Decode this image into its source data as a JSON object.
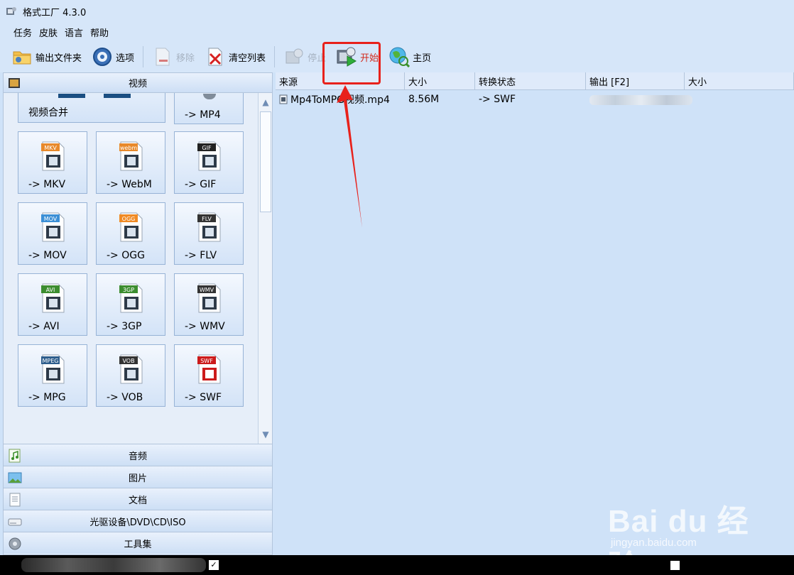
{
  "window": {
    "title": "格式工厂 4.3.0"
  },
  "menu": {
    "items": [
      "任务",
      "皮肤",
      "语言",
      "帮助"
    ]
  },
  "toolbar": {
    "output_folder": "输出文件夹",
    "options": "选项",
    "remove": "移除",
    "clear_list": "清空列表",
    "stop": "停止",
    "start": "开始",
    "home": "主页"
  },
  "left_panel": {
    "video_header": "视频",
    "partial_tiles": [
      "视频合并",
      "-> MP4"
    ],
    "tiles": [
      {
        "label": "-> MKV",
        "badge": "MKV",
        "badge_color": "#e8892a",
        "icon": "film-icon"
      },
      {
        "label": "-> WebM",
        "badge": "webm",
        "badge_color": "#e8892a",
        "icon": "film-icon"
      },
      {
        "label": "-> GIF",
        "badge": "GIF",
        "badge_color": "#222222",
        "icon": "image-icon"
      },
      {
        "label": "-> MOV",
        "badge": "MOV",
        "badge_color": "#3b8fd6",
        "icon": "quicktime-icon"
      },
      {
        "label": "-> OGG",
        "badge": "OGG",
        "badge_color": "#f08a24",
        "icon": "film-icon"
      },
      {
        "label": "-> FLV",
        "badge": "FLV",
        "badge_color": "#333333",
        "icon": "clapper-icon"
      },
      {
        "label": "-> AVI",
        "badge": "AVI",
        "badge_color": "#3c8d2f",
        "icon": "film-icon"
      },
      {
        "label": "-> 3GP",
        "badge": "3GP",
        "badge_color": "#3c8d2f",
        "icon": "phone-film-icon"
      },
      {
        "label": "-> WMV",
        "badge": "WMV",
        "badge_color": "#333333",
        "icon": "camera-icon"
      },
      {
        "label": "-> MPG",
        "badge": "MPEG",
        "badge_color": "#2d5d8c",
        "icon": "reel-icon"
      },
      {
        "label": "-> VOB",
        "badge": "VOB",
        "badge_color": "#333333",
        "icon": "disc-icon"
      },
      {
        "label": "-> SWF",
        "badge": "SWF",
        "badge_color": "#cc1b1b",
        "icon": "flash-icon"
      }
    ],
    "categories": [
      "音频",
      "图片",
      "文档",
      "光驱设备\\DVD\\CD\\ISO",
      "工具集"
    ]
  },
  "table": {
    "columns": [
      "来源",
      "大小",
      "转换状态",
      "输出 [F2]",
      "大小"
    ],
    "rows": [
      {
        "source": "Mp4ToMPG视频.mp4",
        "size": "8.56M",
        "status": "-> SWF"
      }
    ]
  },
  "watermark": {
    "main": "Bai du 经验",
    "sub": "jingyan.baidu.com"
  },
  "accent": {
    "highlight": "#e8211b",
    "start_text": "#d32a1c"
  }
}
